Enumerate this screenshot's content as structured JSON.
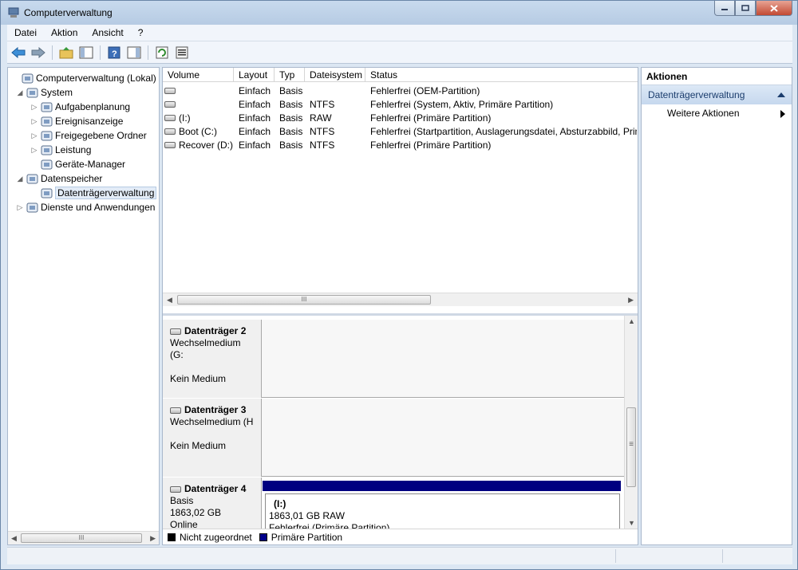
{
  "window": {
    "title": "Computerverwaltung"
  },
  "menu": [
    "Datei",
    "Aktion",
    "Ansicht",
    "?"
  ],
  "tree": {
    "items": [
      {
        "label": "Computerverwaltung (Lokal)",
        "level": 0,
        "expander": "",
        "icon": "computer-management-icon"
      },
      {
        "label": "System",
        "level": 1,
        "expander": "◢",
        "icon": "system-tools-icon"
      },
      {
        "label": "Aufgabenplanung",
        "level": 2,
        "expander": "▷",
        "icon": "clock-icon"
      },
      {
        "label": "Ereignisanzeige",
        "level": 2,
        "expander": "▷",
        "icon": "event-viewer-icon"
      },
      {
        "label": "Freigegebene Ordner",
        "level": 2,
        "expander": "▷",
        "icon": "shared-folder-icon"
      },
      {
        "label": "Leistung",
        "level": 2,
        "expander": "▷",
        "icon": "performance-icon"
      },
      {
        "label": "Geräte-Manager",
        "level": 2,
        "expander": "",
        "icon": "device-manager-icon"
      },
      {
        "label": "Datenspeicher",
        "level": 1,
        "expander": "◢",
        "icon": "storage-icon"
      },
      {
        "label": "Datenträgerverwaltung",
        "level": 2,
        "expander": "",
        "icon": "disk-management-icon",
        "selected": true
      },
      {
        "label": "Dienste und Anwendungen",
        "level": 1,
        "expander": "▷",
        "icon": "services-icon"
      }
    ]
  },
  "volumes": {
    "columns": [
      "Volume",
      "Layout",
      "Typ",
      "Dateisystem",
      "Status"
    ],
    "rows": [
      {
        "volume": "",
        "layout": "Einfach",
        "typ": "Basis",
        "fs": "",
        "status": "Fehlerfrei (OEM-Partition)"
      },
      {
        "volume": "",
        "layout": "Einfach",
        "typ": "Basis",
        "fs": "NTFS",
        "status": "Fehlerfrei (System, Aktiv, Primäre Partition)"
      },
      {
        "volume": "(I:)",
        "layout": "Einfach",
        "typ": "Basis",
        "fs": "RAW",
        "status": "Fehlerfrei (Primäre Partition)"
      },
      {
        "volume": "Boot (C:)",
        "layout": "Einfach",
        "typ": "Basis",
        "fs": "NTFS",
        "status": "Fehlerfrei (Startpartition, Auslagerungsdatei, Absturzabbild, Prim"
      },
      {
        "volume": "Recover (D:)",
        "layout": "Einfach",
        "typ": "Basis",
        "fs": "NTFS",
        "status": "Fehlerfrei (Primäre Partition)"
      }
    ]
  },
  "disks": [
    {
      "name": "Datenträger 2",
      "line1": "Wechselmedium (G:",
      "line2": "",
      "line3": "Kein Medium"
    },
    {
      "name": "Datenträger 3",
      "line1": "Wechselmedium (H",
      "line2": "",
      "line3": "Kein Medium"
    },
    {
      "name": "Datenträger 4",
      "line1": "Basis",
      "line2": "1863,02 GB",
      "line3": "Online",
      "partition": {
        "title": "(I:)",
        "size": "1863,01 GB RAW",
        "status": "Fehlerfrei (Primäre Partition)"
      }
    }
  ],
  "legend": {
    "unallocated": "Nicht zugeordnet",
    "primary": "Primäre Partition",
    "unallocated_color": "#000000",
    "primary_color": "#00008b"
  },
  "actions": {
    "header": "Aktionen",
    "section": "Datenträgerverwaltung",
    "item": "Weitere Aktionen"
  },
  "scroll": {
    "grip": "III",
    "vgrip": "≡"
  }
}
